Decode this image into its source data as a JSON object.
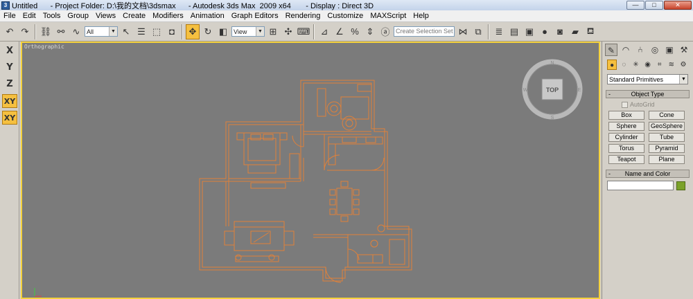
{
  "window": {
    "title": "Untitled      - Project Folder: D:\\我的文档\\3dsmax      - Autodesk 3ds Max  2009 x64       - Display : Direct 3D",
    "app_icon": "3ds-max-icon",
    "controls": [
      "minimize",
      "maximize",
      "close"
    ]
  },
  "menu": [
    "File",
    "Edit",
    "Tools",
    "Group",
    "Views",
    "Create",
    "Modifiers",
    "Animation",
    "Graph Editors",
    "Rendering",
    "Customize",
    "MAXScript",
    "Help"
  ],
  "toolbar": {
    "selection_filter": "All",
    "reference_coord": "View",
    "named_selection_placeholder": "Create Selection Set"
  },
  "axis_buttons": [
    "X",
    "Y",
    "Z",
    "XY",
    "XY"
  ],
  "viewport": {
    "label": "Orthographic",
    "viewcube_label": "TOP",
    "compass": [
      "N",
      "W",
      "E",
      "S"
    ],
    "accent": "#f5d23c",
    "background": "#7b7b7b",
    "wire_color": "#e0813a"
  },
  "command_panel": {
    "primitive_type": "Standard Primitives",
    "object_type_title": "Object Type",
    "autogrid_label": "AutoGrid",
    "objects": [
      "Box",
      "Cone",
      "Sphere",
      "GeoSphere",
      "Cylinder",
      "Tube",
      "Torus",
      "Pyramid",
      "Teapot",
      "Plane"
    ],
    "name_color_title": "Name and Color",
    "name_value": "",
    "swatch_color": "#7ba22a"
  }
}
